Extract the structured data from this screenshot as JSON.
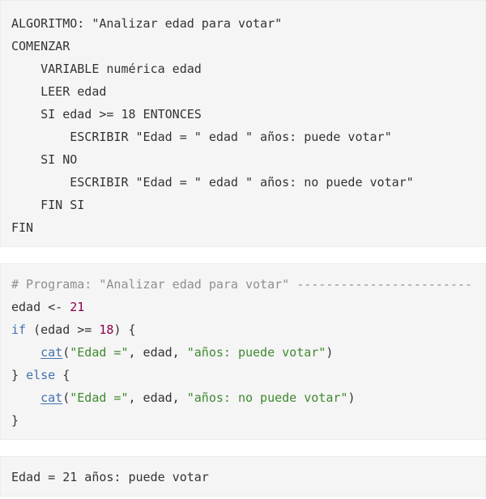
{
  "algorithm": {
    "lines": [
      "ALGORITMO: \"Analizar edad para votar\"",
      "COMENZAR",
      "    VARIABLE numérica edad",
      "    LEER edad",
      "    SI edad >= 18 ENTONCES",
      "        ESCRIBIR \"Edad = \" edad \" años: puede votar\"",
      "    SI NO",
      "        ESCRIBIR \"Edad = \" edad \" años: no puede votar\"",
      "    FIN SI",
      "FIN"
    ]
  },
  "code": {
    "comment": "# Programa: \"Analizar edad para votar\" ------------------------",
    "l1_var": "edad <- ",
    "l1_num": "21",
    "l2_kw": "if",
    "l2_a": " (edad >= ",
    "l2_num": "18",
    "l2_b": ") {",
    "l3_indent": "    ",
    "l3_fn": "cat",
    "l3_a": "(",
    "l3_str1": "\"Edad =\"",
    "l3_b": ", edad, ",
    "l3_str2": "\"años: puede votar\"",
    "l3_c": ")",
    "l4_a": "} ",
    "l4_kw": "else",
    "l4_b": " {",
    "l5_indent": "    ",
    "l5_fn": "cat",
    "l5_a": "(",
    "l5_str1": "\"Edad =\"",
    "l5_b": ", edad, ",
    "l5_str2": "\"años: no puede votar\"",
    "l5_c": ")",
    "l6": "}"
  },
  "output": {
    "text": "Edad = 21 años: puede votar"
  },
  "colors": {
    "background": "#f5f5f5",
    "comment": "#8e908c",
    "keyword": "#4271ae",
    "number": "#8e004b",
    "string": "#3e8a2f"
  }
}
